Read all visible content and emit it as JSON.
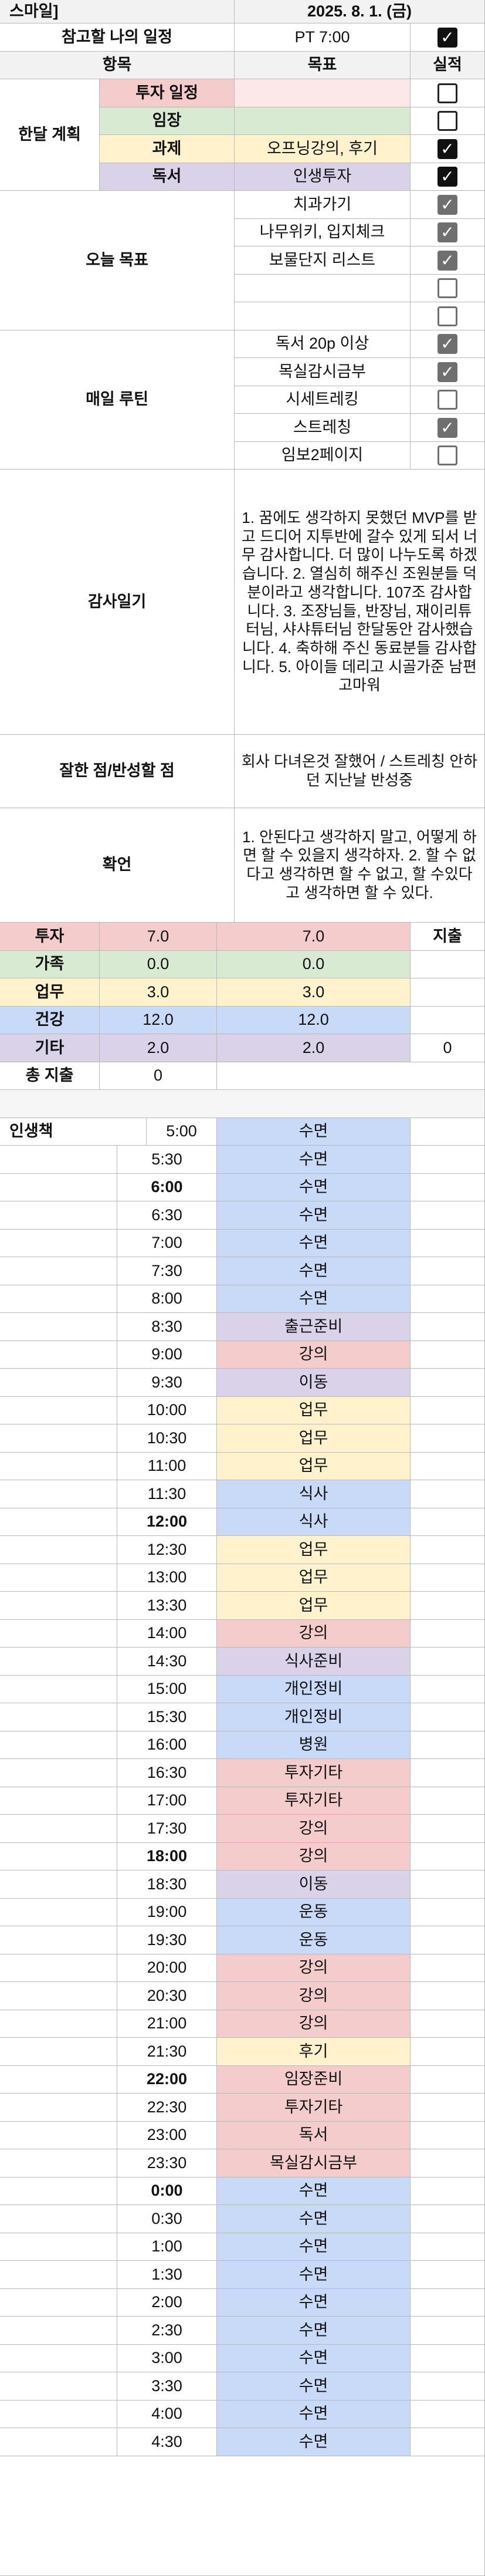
{
  "colors": {
    "pink": "#f4cccc",
    "green": "#d9ead3",
    "yellow": "#fff2cc",
    "blue": "#c9daf8",
    "purple": "#d9d2e9",
    "lightpink": "#fce8e8",
    "lightblue": "#cfe2f3",
    "header": "#f2f2f2"
  },
  "header": {
    "title_fragment": "스마일]",
    "date": "2025. 8. 1. (금)"
  },
  "schedule_row": {
    "label": "참고할 나의 일정",
    "value": "PT 7:00",
    "checked": true
  },
  "columns": {
    "item": "항목",
    "goal": "목표",
    "result": "실적"
  },
  "monthly": {
    "label": "한달 계획",
    "rows": [
      {
        "name": "투자 일정",
        "color": "pink",
        "goal": "",
        "checked": false
      },
      {
        "name": "임장",
        "color": "green",
        "goal": "",
        "checked": false
      },
      {
        "name": "과제",
        "color": "yellow",
        "goal": "오프닝강의, 후기",
        "checked": true
      },
      {
        "name": "독서",
        "color": "purple",
        "goal": "인생투자",
        "checked": true
      }
    ]
  },
  "today_goals": {
    "label": "오늘 목표",
    "rows": [
      {
        "goal": "치과가기",
        "checked": true
      },
      {
        "goal": "나무위키, 입지체크",
        "checked": true
      },
      {
        "goal": "보물단지 리스트",
        "checked": true
      },
      {
        "goal": "",
        "checked": false
      },
      {
        "goal": "",
        "checked": false
      }
    ]
  },
  "daily_routine": {
    "label": "매일 루틴",
    "rows": [
      {
        "goal": "독서 20p 이상",
        "checked": true
      },
      {
        "goal": "목실감시금부",
        "checked": true
      },
      {
        "goal": "시세트레킹",
        "checked": false
      },
      {
        "goal": "스트레칭",
        "checked": true
      },
      {
        "goal": "임보2페이지",
        "checked": false
      }
    ]
  },
  "gratitude": {
    "label": "감사일기",
    "text": "1. 꿈에도 생각하지 못했던 MVP를 받고 드디어 지투반에 갈수 있게 되서 너무 감사합니다. 더 많이 나누도록 하겠습니다. 2. 열심히 해주신 조원분들 덕분이라고 생각합니다. 107조 감사합니다. 3. 조장님들, 반장님, 재이리튜터님, 샤샤튜터님 한달동안 감사했습니다. 4. 축하해 주신 동료분들 감사합니다. 5. 아이들 데리고 시골가준 남편 고마워"
  },
  "reflection": {
    "label": "잘한 점/반성할 점",
    "text": "회사 다녀온것 잘했어 / 스트레칭 안하던 지난날 반성중"
  },
  "affirmation": {
    "label": "확언",
    "text": "1. 안된다고 생각하지 말고, 어떻게 하면 할 수 있을지 생각하자. 2. 할 수 없다고 생각하면 할 수 없고, 할 수있다고 생각하면 할 수 있다."
  },
  "spending": {
    "expense_label": "지출",
    "rows": [
      {
        "name": "투자",
        "color": "pink",
        "planned": "7.0",
        "actual": "7.0",
        "expense": ""
      },
      {
        "name": "가족",
        "color": "green",
        "planned": "0.0",
        "actual": "0.0",
        "expense": ""
      },
      {
        "name": "업무",
        "color": "yellow",
        "planned": "3.0",
        "actual": "3.0",
        "expense": ""
      },
      {
        "name": "건강",
        "color": "blue",
        "planned": "12.0",
        "actual": "12.0",
        "expense": ""
      },
      {
        "name": "기타",
        "color": "purple",
        "planned": "2.0",
        "actual": "2.0",
        "expense": "0"
      }
    ],
    "total_label": "총 지출",
    "total_value": "0"
  },
  "timetable": {
    "label": "인생책",
    "slots": [
      {
        "time": "5:00",
        "activity": "수면",
        "color": "blue"
      },
      {
        "time": "5:30",
        "activity": "수면",
        "color": "blue"
      },
      {
        "time": "6:00",
        "activity": "수면",
        "color": "blue",
        "bold": true
      },
      {
        "time": "6:30",
        "activity": "수면",
        "color": "blue"
      },
      {
        "time": "7:00",
        "activity": "수면",
        "color": "blue"
      },
      {
        "time": "7:30",
        "activity": "수면",
        "color": "blue"
      },
      {
        "time": "8:00",
        "activity": "수면",
        "color": "blue"
      },
      {
        "time": "8:30",
        "activity": "출근준비",
        "color": "purple"
      },
      {
        "time": "9:00",
        "activity": "강의",
        "color": "pink"
      },
      {
        "time": "9:30",
        "activity": "이동",
        "color": "purple"
      },
      {
        "time": "10:00",
        "activity": "업무",
        "color": "yellow"
      },
      {
        "time": "10:30",
        "activity": "업무",
        "color": "yellow"
      },
      {
        "time": "11:00",
        "activity": "업무",
        "color": "yellow"
      },
      {
        "time": "11:30",
        "activity": "식사",
        "color": "blue"
      },
      {
        "time": "12:00",
        "activity": "식사",
        "color": "blue",
        "bold": true
      },
      {
        "time": "12:30",
        "activity": "업무",
        "color": "yellow"
      },
      {
        "time": "13:00",
        "activity": "업무",
        "color": "yellow"
      },
      {
        "time": "13:30",
        "activity": "업무",
        "color": "yellow"
      },
      {
        "time": "14:00",
        "activity": "강의",
        "color": "pink"
      },
      {
        "time": "14:30",
        "activity": "식사준비",
        "color": "purple"
      },
      {
        "time": "15:00",
        "activity": "개인정비",
        "color": "blue"
      },
      {
        "time": "15:30",
        "activity": "개인정비",
        "color": "blue"
      },
      {
        "time": "16:00",
        "activity": "병원",
        "color": "blue"
      },
      {
        "time": "16:30",
        "activity": "투자기타",
        "color": "pink"
      },
      {
        "time": "17:00",
        "activity": "투자기타",
        "color": "pink"
      },
      {
        "time": "17:30",
        "activity": "강의",
        "color": "pink"
      },
      {
        "time": "18:00",
        "activity": "강의",
        "color": "pink",
        "bold": true
      },
      {
        "time": "18:30",
        "activity": "이동",
        "color": "purple"
      },
      {
        "time": "19:00",
        "activity": "운동",
        "color": "blue"
      },
      {
        "time": "19:30",
        "activity": "운동",
        "color": "blue"
      },
      {
        "time": "20:00",
        "activity": "강의",
        "color": "pink"
      },
      {
        "time": "20:30",
        "activity": "강의",
        "color": "pink"
      },
      {
        "time": "21:00",
        "activity": "강의",
        "color": "pink"
      },
      {
        "time": "21:30",
        "activity": "후기",
        "color": "yellow"
      },
      {
        "time": "22:00",
        "activity": "임장준비",
        "color": "pink",
        "bold": true
      },
      {
        "time": "22:30",
        "activity": "투자기타",
        "color": "pink"
      },
      {
        "time": "23:00",
        "activity": "독서",
        "color": "pink"
      },
      {
        "time": "23:30",
        "activity": "목실감시금부",
        "color": "pink"
      },
      {
        "time": "0:00",
        "activity": "수면",
        "color": "blue",
        "bold": true
      },
      {
        "time": "0:30",
        "activity": "수면",
        "color": "blue"
      },
      {
        "time": "1:00",
        "activity": "수면",
        "color": "blue"
      },
      {
        "time": "1:30",
        "activity": "수면",
        "color": "blue"
      },
      {
        "time": "2:00",
        "activity": "수면",
        "color": "blue"
      },
      {
        "time": "2:30",
        "activity": "수면",
        "color": "blue"
      },
      {
        "time": "3:00",
        "activity": "수면",
        "color": "blue"
      },
      {
        "time": "3:30",
        "activity": "수면",
        "color": "blue"
      },
      {
        "time": "4:00",
        "activity": "수면",
        "color": "blue"
      },
      {
        "time": "4:30",
        "activity": "수면",
        "color": "blue"
      }
    ]
  }
}
